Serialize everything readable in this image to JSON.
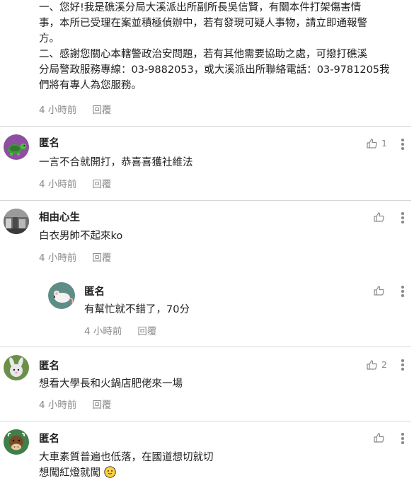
{
  "comments": [
    {
      "lines": [
        "一、您好!我是礁溪分局大溪派出所副所長吳信賢，有關本件打架傷害情",
        "事，本所已受理在案並積極偵辦中，若有發現可疑人事物，請立即通報警",
        "方。",
        "二、感謝您關心本轄警政治安問題，若有其他需要協助之處，可撥打礁溪",
        "分局警政服務專線：03-9882053，或大溪派出所聯絡電話：03-9781205我",
        "們將有專人為您服務。"
      ],
      "time": "4 小時前",
      "reply": "回覆"
    },
    {
      "author": "匿名",
      "avatar": "turtle-icon",
      "avatar_bg": "#8e4fa0",
      "text": "一言不合就開打，恭喜喜獲社維法",
      "time": "4 小時前",
      "reply": "回覆",
      "likes": "1"
    },
    {
      "author": "相由心生",
      "avatar": "photo-avatar",
      "avatar_bg": "#777777",
      "text": "白衣男帥不起來ko",
      "time": "4 小時前",
      "reply": "回覆",
      "likes": ""
    },
    {
      "author": "匿名",
      "avatar": "rat-icon",
      "avatar_bg": "#5e8d86",
      "text": "有幫忙就不錯了，70分",
      "time": "4 小時前",
      "reply": "回覆",
      "likes": ""
    },
    {
      "author": "匿名",
      "avatar": "rabbit-icon",
      "avatar_bg": "#6b8f4a",
      "text": "想看大學長和火鍋店肥佬來一場",
      "time": "4 小時前",
      "reply": "回覆",
      "likes": "2"
    },
    {
      "author": "匿名",
      "avatar": "cow-icon",
      "avatar_bg": "#3f7f4a",
      "text1": "大車素質普遍也低落，在國道想切就切",
      "text2": "想闖紅燈就闖",
      "emoji": "smiling-face-emoji",
      "likes": ""
    }
  ]
}
